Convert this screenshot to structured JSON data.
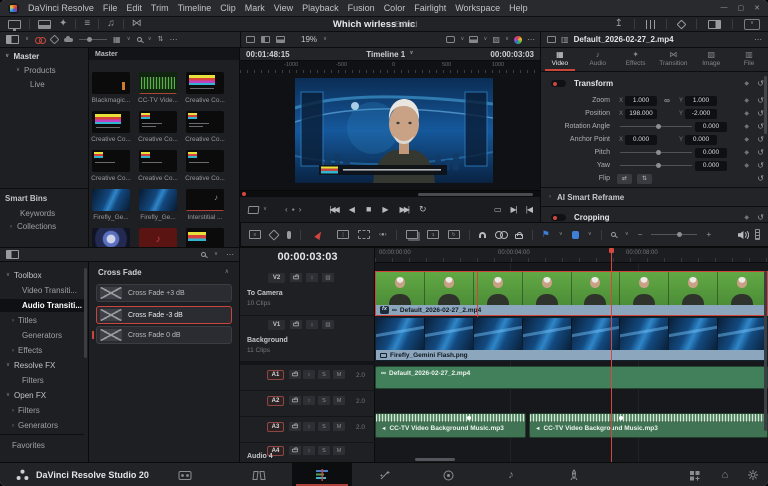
{
  "window": {
    "app_name": "DaVinci Resolve",
    "menus": [
      "File",
      "Edit",
      "Trim",
      "Timeline",
      "Clip",
      "Mark",
      "View",
      "Playback",
      "Fusion",
      "Color",
      "Fairlight",
      "Workspace",
      "Help"
    ],
    "project_title": "Which wirless mic",
    "edited_badge": "Edited"
  },
  "icons": {
    "caret_down": "∨",
    "caret_up": "∧",
    "chevron_right": "›",
    "dots_h": "⋯",
    "play": "▶",
    "stop": "■",
    "step_back": "◀",
    "skip_back": "|◀◀",
    "skip_fwd": "▶▶|",
    "loop": "↻",
    "loop_range": "▭",
    "play_around": "▶|",
    "goto_in": "|◀",
    "jog_left": "‹",
    "jog_dot": "●",
    "jog_right": "›",
    "keyframe_diamond": "◆",
    "reset_arrow": "↺",
    "link_chain": "∞",
    "flag": "⚑",
    "auto_select": "↕",
    "flip_h": "⇄",
    "flip_v": "⇅",
    "music_note": "♪",
    "music_notes": "♫",
    "magic_wand": "✦",
    "index_list": "≡",
    "grid_view": "▦",
    "transition_bowtie": "⋈",
    "image_frame": "▨",
    "film_frame": "▥",
    "sort": "⇅",
    "plus": "+",
    "minus": "−",
    "speaker": "◄",
    "home": "⌂",
    "export_up": "↥",
    "window_min": "—",
    "window_max": "▢",
    "window_close": "✕"
  },
  "media_pool": {
    "path": "Master",
    "bins": [
      {
        "label": "Master"
      },
      {
        "label": "Products"
      },
      {
        "label": "Live"
      }
    ],
    "smart_bins": {
      "title": "Smart Bins",
      "items": [
        {
          "label": "Keywords"
        },
        {
          "label": "Collections"
        }
      ]
    },
    "clips": [
      {
        "label": "Blackmagic..."
      },
      {
        "label": "CC-TV Vide..."
      },
      {
        "label": "Creative Co..."
      },
      {
        "label": "Creative Co..."
      },
      {
        "label": "Creative Co..."
      },
      {
        "label": "Creative Co..."
      },
      {
        "label": "Creative Co..."
      },
      {
        "label": "Creative Co..."
      },
      {
        "label": "Creative Co..."
      },
      {
        "label": "Firefly_Ge..."
      },
      {
        "label": "Firefly_Ge..."
      },
      {
        "label": "Interstitial ..."
      }
    ]
  },
  "viewer": {
    "left_timecode": "00:01:48:15",
    "timeline_name": "Timeline 1",
    "right_timecode": "00:00:03:03",
    "zoom_level": "19%",
    "ruler_labels": [
      "-1000",
      "-500",
      "0",
      "500",
      "1000"
    ]
  },
  "inspector": {
    "clip_name": "Default_2026-02-27_2.mp4",
    "tabs": [
      {
        "label": "Video"
      },
      {
        "label": "Audio"
      },
      {
        "label": "Effects"
      },
      {
        "label": "Transition"
      },
      {
        "label": "Image"
      },
      {
        "label": "File"
      }
    ],
    "transform": {
      "title": "Transform",
      "x_label": "X",
      "y_label": "Y",
      "rows": {
        "zoom": {
          "label": "Zoom",
          "x": "1.000",
          "y": "1.000"
        },
        "position": {
          "label": "Position",
          "x": "198.000",
          "y": "-2.000"
        },
        "rotation": {
          "label": "Rotation Angle",
          "value": "0.000"
        },
        "anchor": {
          "label": "Anchor Point",
          "x": "0.000",
          "y": "0.000"
        },
        "pitch": {
          "label": "Pitch",
          "value": "0.000"
        },
        "yaw": {
          "label": "Yaw",
          "value": "0.000"
        },
        "flip": {
          "label": "Flip"
        }
      }
    },
    "sections": {
      "ai_smart_reframe": "AI Smart Reframe",
      "cropping": "Cropping"
    }
  },
  "effects_panel": {
    "tree": [
      {
        "label": "Toolbox"
      },
      {
        "label": "Video Transiti..."
      },
      {
        "label": "Audio Transiti..."
      },
      {
        "label": "Titles"
      },
      {
        "label": "Generators"
      },
      {
        "label": "Effects"
      },
      {
        "label": "Resolve FX"
      },
      {
        "label": "Filters"
      },
      {
        "label": "Open FX"
      },
      {
        "label": "Filters"
      },
      {
        "label": "Generators"
      },
      {
        "label": "Favorites"
      }
    ],
    "group_title": "Cross Fade",
    "items": [
      {
        "label": "Cross Fade +3 dB"
      },
      {
        "label": "Cross Fade -3 dB"
      },
      {
        "label": "Cross Fade 0 dB"
      }
    ]
  },
  "timeline": {
    "timecode": "00:00:03:03",
    "ruler": [
      "00:00:00:00",
      "00:00:04:00",
      "00:00:08:00"
    ],
    "controls": {
      "solo": "S",
      "mute": "M",
      "channels": "2.0"
    },
    "tracks": {
      "v2": {
        "id": "V2",
        "name": "To Camera",
        "count": "10 Clips"
      },
      "v1": {
        "id": "V1",
        "name": "Background",
        "count": "11 Clips"
      },
      "a1": {
        "id": "A1"
      },
      "a2": {
        "id": "A2"
      },
      "a3": {
        "id": "A3"
      },
      "a4": {
        "id": "A4",
        "name": "Audio 4"
      }
    },
    "clips": {
      "fx_badge": "fx",
      "v2": "Default_2026-02-27_2.mp4",
      "v1": "Firefly_Gemini Flash.png",
      "a1": "Default_2026-02-27_2.mp4",
      "a3_1": "CC-TV Video Background Music.mp3",
      "a3_2": "CC-TV Video Background Music.mp3"
    }
  },
  "status_bar": {
    "app_label": "DaVinci Resolve Studio 20"
  },
  "colors": {
    "accent_red": "#c9463d",
    "selection_red": "#d0453c",
    "marker_blue": "#3f7fd6",
    "clip_label_blue": "#8ba6bd",
    "audio_clip_green": "#41805a",
    "chroma_green": "#55a040"
  }
}
